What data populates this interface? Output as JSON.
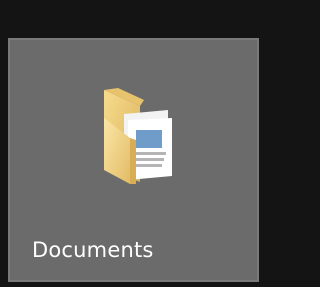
{
  "tile": {
    "label": "Documents",
    "icon": "folder-documents-icon"
  },
  "colors": {
    "background": "#141414",
    "tile_fill": "#6b6b6b",
    "tile_border": "#7a7a7a",
    "folder_yellow": "#f4d27a",
    "label_text": "#ffffff"
  }
}
